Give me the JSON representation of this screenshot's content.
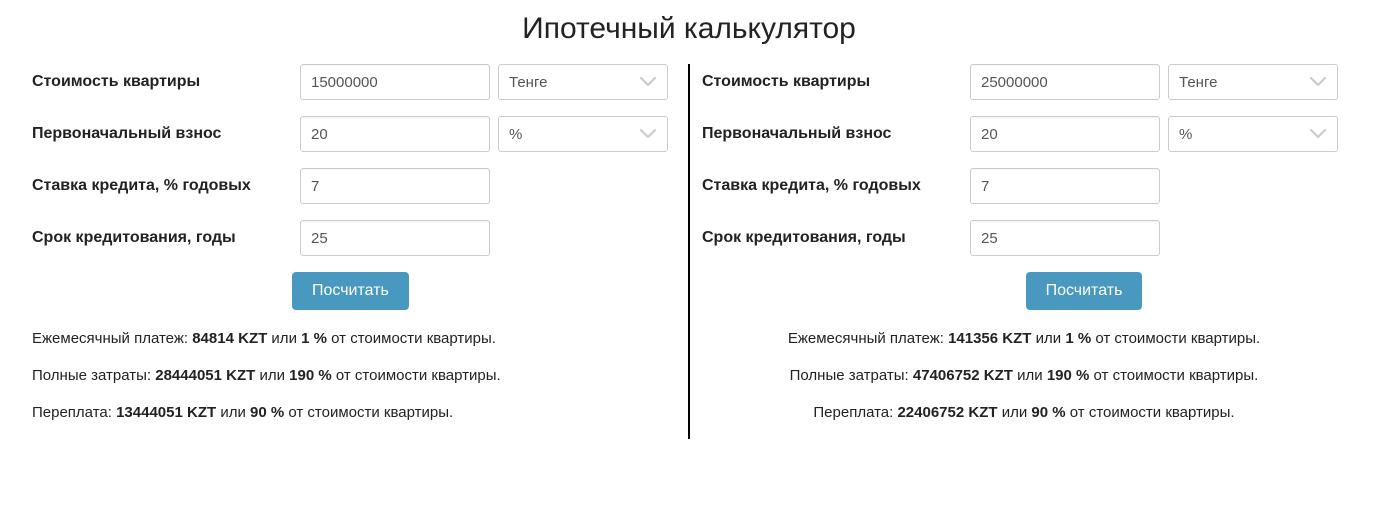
{
  "title": "Ипотечный калькулятор",
  "labels": {
    "price": "Стоимость квартиры",
    "down": "Первоначальный взнос",
    "rate": "Ставка кредита, % годовых",
    "term": "Срок кредитования, годы",
    "calc": "Посчитать",
    "currency": "Тенге",
    "percent": "%",
    "monthly_prefix": "Ежемесячный платеж: ",
    "total_prefix": "Полные затраты:  ",
    "over_prefix": "Переплата: ",
    "kzt": " KZT",
    "or": " или ",
    "pct_suffix": " %",
    "tail": " от стоимости квартиры."
  },
  "left": {
    "price": "15000000",
    "down": "20",
    "rate": "7",
    "term": "25",
    "monthly_val": "84814",
    "monthly_pct": "1",
    "total_val": "28444051",
    "total_pct": "190",
    "over_val": "13444051",
    "over_pct": "90"
  },
  "right": {
    "price": "25000000",
    "down": "20",
    "rate": "7",
    "term": "25",
    "monthly_val": "141356",
    "monthly_pct": "1",
    "total_val": "47406752",
    "total_pct": "190",
    "over_val": "22406752",
    "over_pct": "90"
  }
}
